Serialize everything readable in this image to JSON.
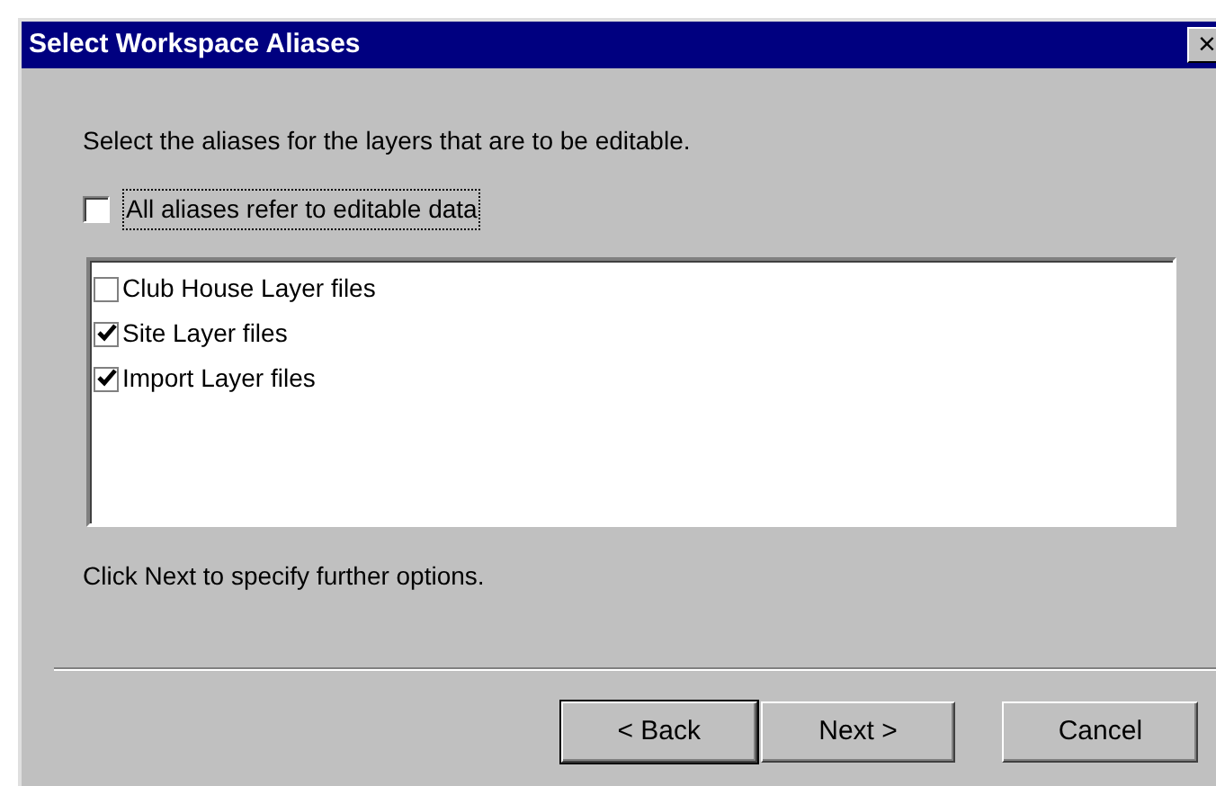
{
  "window": {
    "title": "Select Workspace Aliases",
    "close": "×"
  },
  "instruction": "Select the aliases for the layers that are to be editable.",
  "all_aliases": {
    "label": "All aliases refer to editable data",
    "checked": false,
    "focused": true
  },
  "aliases": [
    {
      "label": "Club House Layer files",
      "checked": false
    },
    {
      "label": "Site Layer files",
      "checked": true
    },
    {
      "label": "Import Layer files",
      "checked": true
    }
  ],
  "hint": "Click Next to specify further options.",
  "buttons": [
    {
      "label": "< Back",
      "default": true
    },
    {
      "label": "Next >",
      "default": false
    },
    {
      "label": "Cancel",
      "default": false
    }
  ]
}
